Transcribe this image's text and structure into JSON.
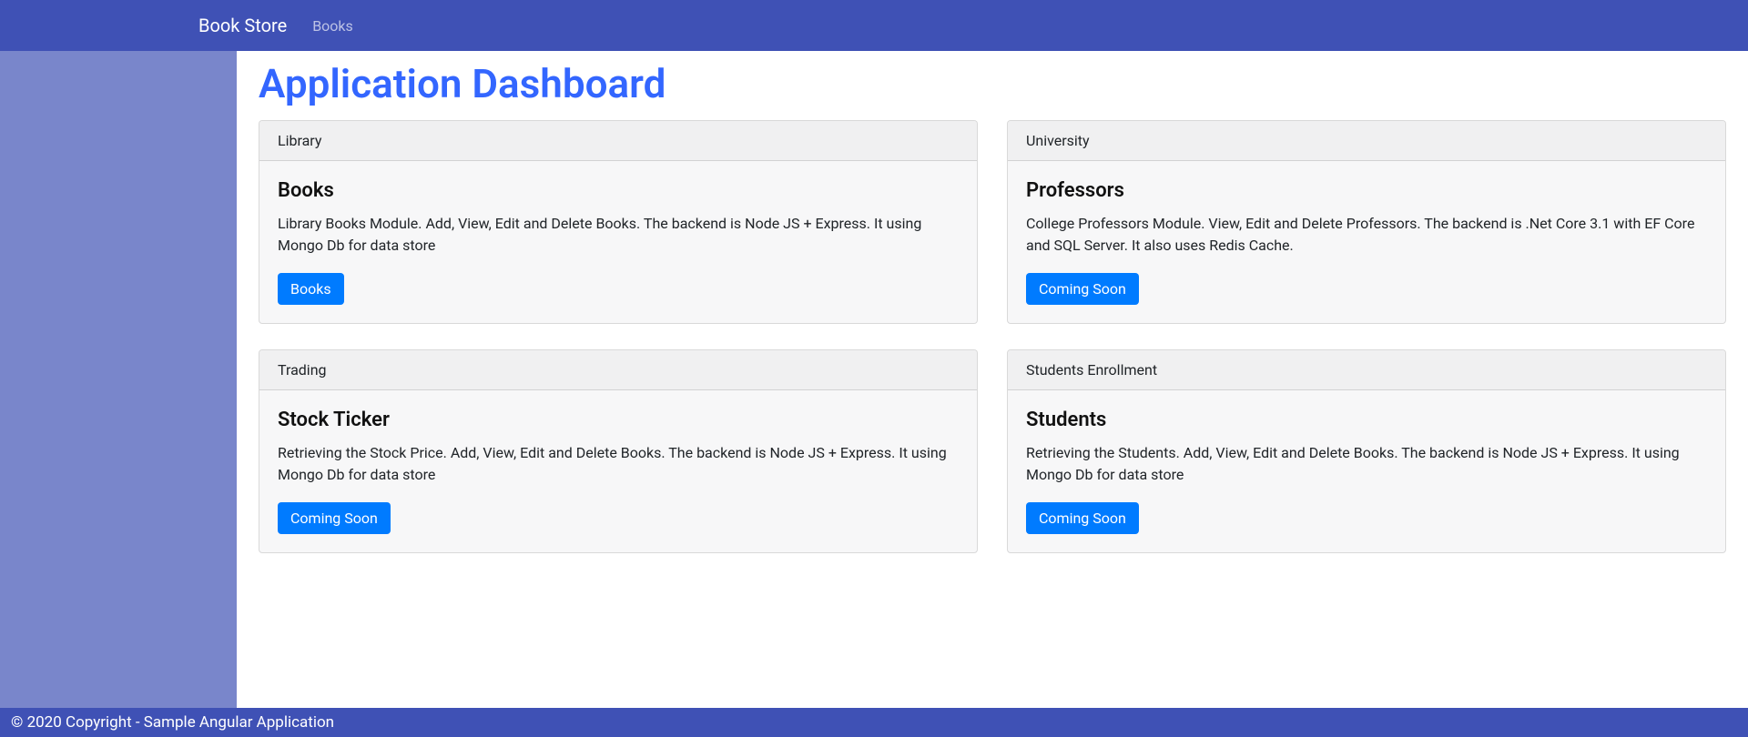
{
  "nav": {
    "brand": "Book Store",
    "links": [
      {
        "label": "Books"
      }
    ]
  },
  "page": {
    "title": "Application Dashboard"
  },
  "cards": [
    {
      "header": "Library",
      "title": "Books",
      "desc": "Library Books Module. Add, View, Edit and Delete Books. The backend is Node JS + Express. It using Mongo Db for data store",
      "button": "Books"
    },
    {
      "header": "University",
      "title": "Professors",
      "desc": "College Professors Module. View, Edit and Delete Professors. The backend is .Net Core 3.1 with EF Core and SQL Server. It also uses Redis Cache.",
      "button": "Coming Soon"
    },
    {
      "header": "Trading",
      "title": "Stock Ticker",
      "desc": "Retrieving the Stock Price. Add, View, Edit and Delete Books. The backend is Node JS + Express. It using Mongo Db for data store",
      "button": "Coming Soon"
    },
    {
      "header": "Students Enrollment",
      "title": "Students",
      "desc": "Retrieving the Students. Add, View, Edit and Delete Books. The backend is Node JS + Express. It using Mongo Db for data store",
      "button": "Coming Soon"
    }
  ],
  "footer": {
    "text": "© 2020 Copyright - Sample Angular Application"
  }
}
